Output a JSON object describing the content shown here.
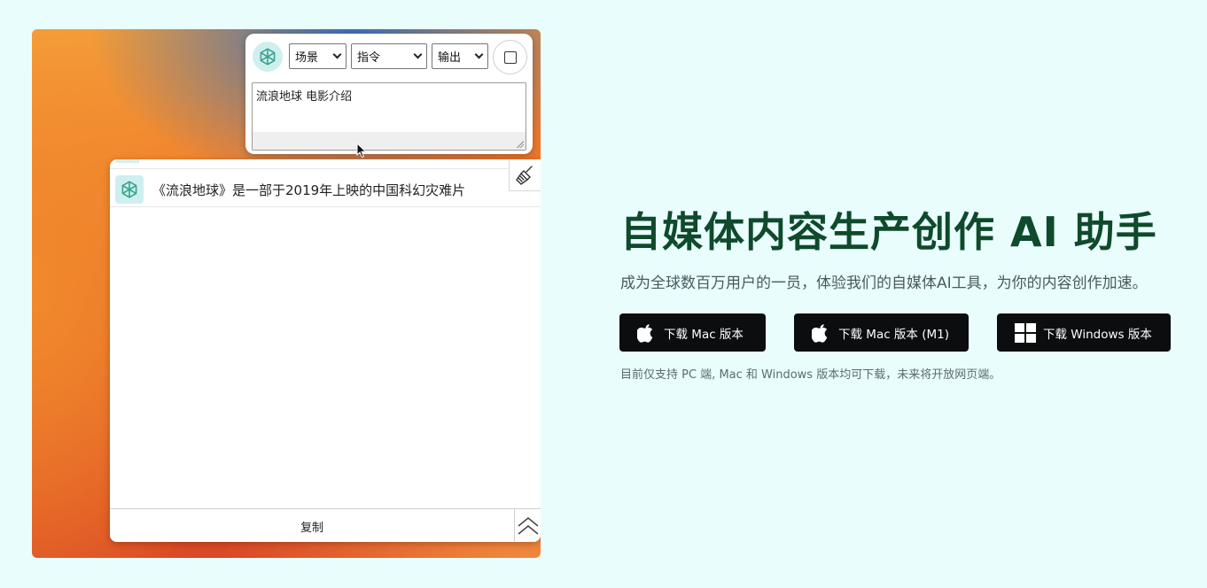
{
  "prompt_window": {
    "scene_select": "场景",
    "instruction_select": "指令",
    "output_select": "输出",
    "prompt_text": "流浪地球 电影介绍"
  },
  "answer_window": {
    "answer_text": "《流浪地球》是一部于2019年上映的中国科幻灾难片",
    "copy_label": "复制"
  },
  "hero": {
    "title": "自媒体内容生产创作 AI 助手",
    "subtitle": "成为全球数百万用户的一员，体验我们的自媒体AI工具，为你的内容创作加速。",
    "buttons": {
      "mac": "下载 Mac 版本",
      "mac_m1": "下载 Mac 版本 (M1)",
      "windows": "下载 Windows 版本"
    },
    "note": "目前仅支持 PC 端, Mac 和 Windows 版本均可下载，未来将开放网页端。"
  },
  "icons": {
    "app_logo": "openai-logo-icon",
    "clear": "broom-icon",
    "collapse": "double-chevron-up-icon",
    "mac": "apple-icon",
    "windows": "windows-icon"
  },
  "colors": {
    "page_background": "#e9fdfd",
    "title": "#0e4a2b",
    "button_background": "#0b0d0e",
    "logo_background": "#cfefef"
  }
}
